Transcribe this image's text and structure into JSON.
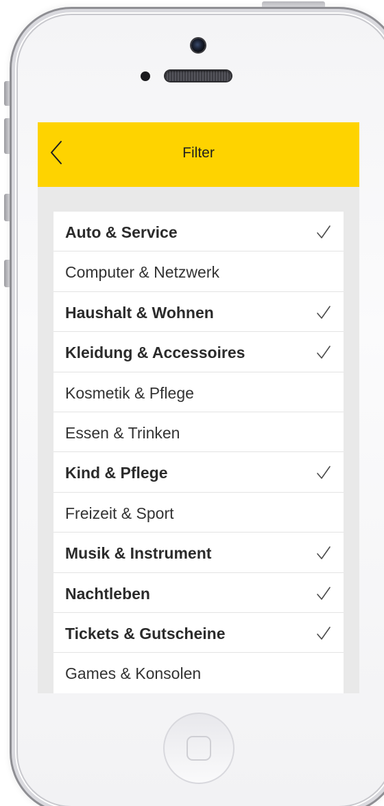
{
  "header": {
    "title": "Filter",
    "back_icon": "chevron-left-icon"
  },
  "colors": {
    "navbar": "#fed300",
    "background": "#e9e9e9",
    "row_background": "#ffffff",
    "text": "#333333"
  },
  "filters": [
    {
      "label": "Auto & Service",
      "selected": true
    },
    {
      "label": "Computer & Netzwerk",
      "selected": false
    },
    {
      "label": "Haushalt & Wohnen",
      "selected": true
    },
    {
      "label": "Kleidung & Accessoires",
      "selected": true
    },
    {
      "label": "Kosmetik & Pflege",
      "selected": false
    },
    {
      "label": "Essen & Trinken",
      "selected": false
    },
    {
      "label": "Kind & Pflege",
      "selected": true
    },
    {
      "label": "Freizeit & Sport",
      "selected": false
    },
    {
      "label": "Musik & Instrument",
      "selected": true
    },
    {
      "label": "Nachtleben",
      "selected": true
    },
    {
      "label": "Tickets & Gutscheine",
      "selected": true
    },
    {
      "label": "Games & Konsolen",
      "selected": false
    }
  ]
}
